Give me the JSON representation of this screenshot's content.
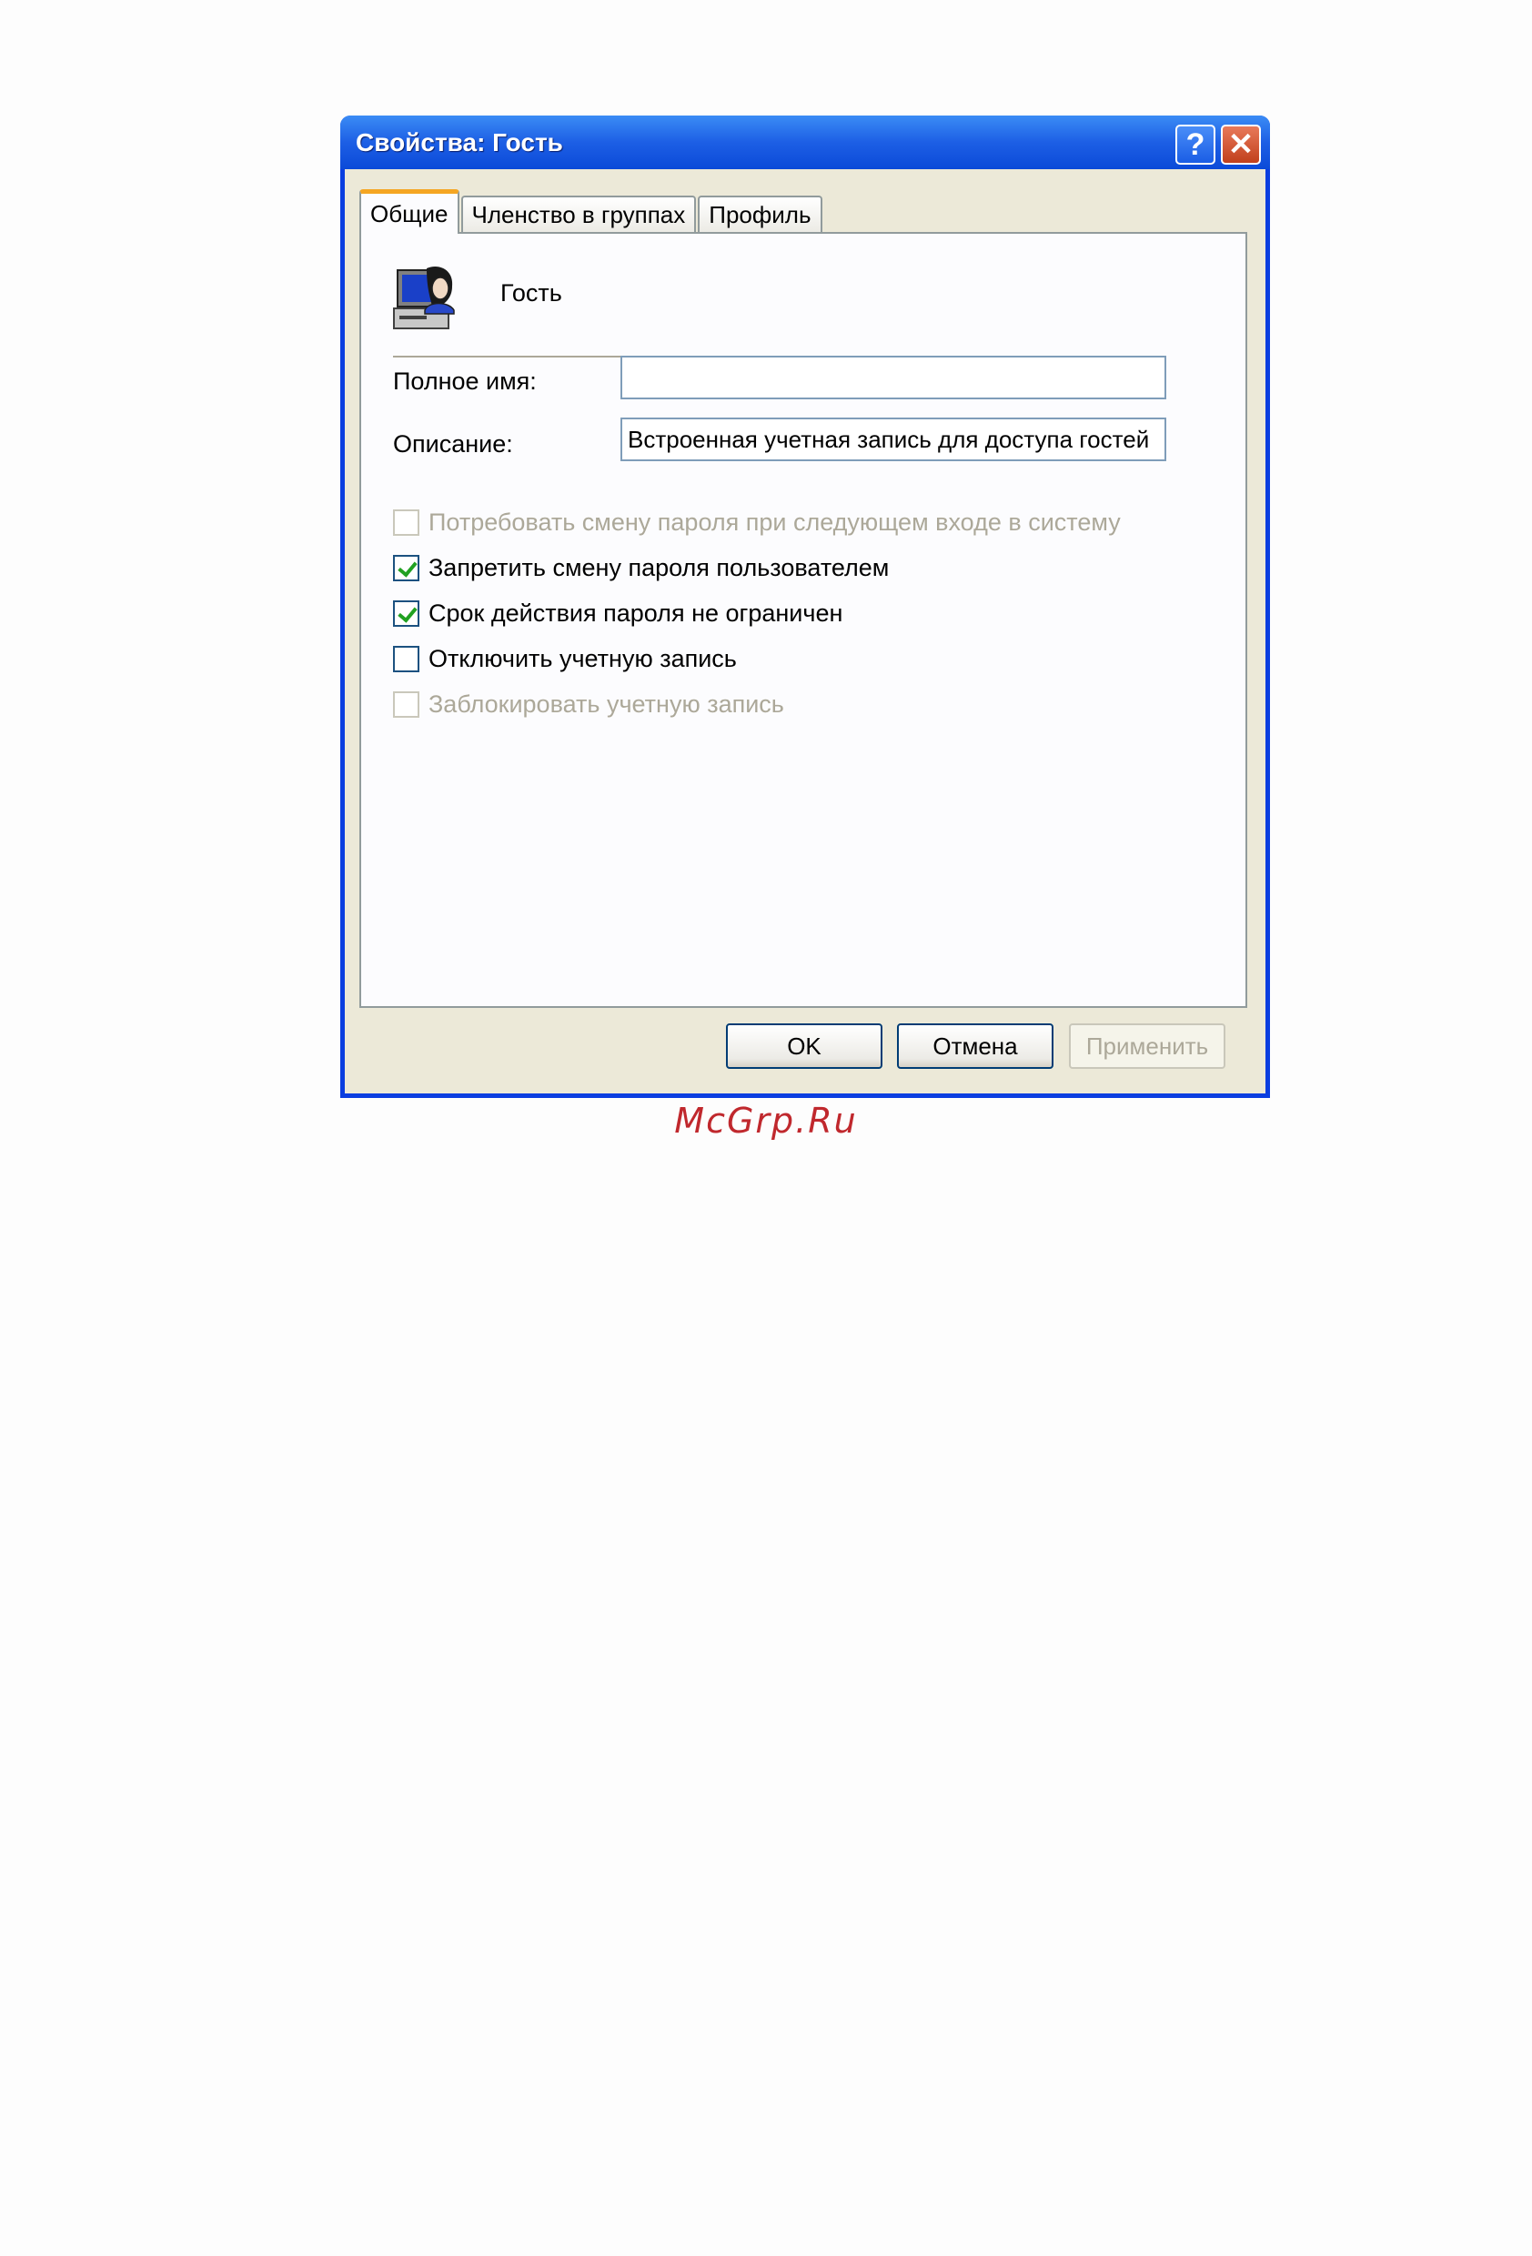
{
  "window": {
    "title": "Свойства: Гость",
    "help_glyph": "?",
    "close_glyph": "✕"
  },
  "tabs": [
    {
      "label": "Общие",
      "active": true
    },
    {
      "label": "Членство в группах",
      "active": false
    },
    {
      "label": "Профиль",
      "active": false
    }
  ],
  "general": {
    "user_icon": "user-computer-icon",
    "user_name": "Гость",
    "full_name_label": "Полное имя:",
    "full_name_value": "",
    "description_label": "Описание:",
    "description_value": "Встроенная учетная запись для доступа гостей",
    "options": [
      {
        "label": "Потребовать смену пароля при следующем входе в систему",
        "checked": false,
        "disabled": true
      },
      {
        "label": "Запретить смену пароля пользователем",
        "checked": true,
        "disabled": false
      },
      {
        "label": "Срок действия пароля не ограничен",
        "checked": true,
        "disabled": false
      },
      {
        "label": "Отключить учетную запись",
        "checked": false,
        "disabled": false
      },
      {
        "label": "Заблокировать учетную запись",
        "checked": false,
        "disabled": true
      }
    ]
  },
  "buttons": {
    "ok": "OK",
    "cancel": "Отмена",
    "apply": "Применить"
  },
  "watermark": "McGrp.Ru",
  "colors": {
    "titlebar": "#1d5fe5",
    "dialog_bg": "#ece9d8",
    "active_tab_accent": "#f5a623",
    "check": "#21a121",
    "watermark": "#c0282d"
  }
}
